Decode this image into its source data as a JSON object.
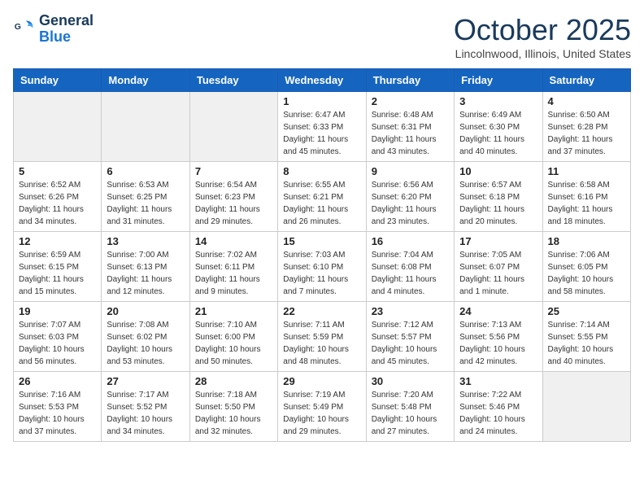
{
  "header": {
    "logo_line1": "General",
    "logo_line2": "Blue",
    "month_title": "October 2025",
    "location": "Lincolnwood, Illinois, United States"
  },
  "weekdays": [
    "Sunday",
    "Monday",
    "Tuesday",
    "Wednesday",
    "Thursday",
    "Friday",
    "Saturday"
  ],
  "weeks": [
    [
      {
        "day": "",
        "info": "",
        "gray": true
      },
      {
        "day": "",
        "info": "",
        "gray": true
      },
      {
        "day": "",
        "info": "",
        "gray": true
      },
      {
        "day": "1",
        "info": "Sunrise: 6:47 AM\nSunset: 6:33 PM\nDaylight: 11 hours\nand 45 minutes.",
        "gray": false
      },
      {
        "day": "2",
        "info": "Sunrise: 6:48 AM\nSunset: 6:31 PM\nDaylight: 11 hours\nand 43 minutes.",
        "gray": false
      },
      {
        "day": "3",
        "info": "Sunrise: 6:49 AM\nSunset: 6:30 PM\nDaylight: 11 hours\nand 40 minutes.",
        "gray": false
      },
      {
        "day": "4",
        "info": "Sunrise: 6:50 AM\nSunset: 6:28 PM\nDaylight: 11 hours\nand 37 minutes.",
        "gray": false
      }
    ],
    [
      {
        "day": "5",
        "info": "Sunrise: 6:52 AM\nSunset: 6:26 PM\nDaylight: 11 hours\nand 34 minutes.",
        "gray": false
      },
      {
        "day": "6",
        "info": "Sunrise: 6:53 AM\nSunset: 6:25 PM\nDaylight: 11 hours\nand 31 minutes.",
        "gray": false
      },
      {
        "day": "7",
        "info": "Sunrise: 6:54 AM\nSunset: 6:23 PM\nDaylight: 11 hours\nand 29 minutes.",
        "gray": false
      },
      {
        "day": "8",
        "info": "Sunrise: 6:55 AM\nSunset: 6:21 PM\nDaylight: 11 hours\nand 26 minutes.",
        "gray": false
      },
      {
        "day": "9",
        "info": "Sunrise: 6:56 AM\nSunset: 6:20 PM\nDaylight: 11 hours\nand 23 minutes.",
        "gray": false
      },
      {
        "day": "10",
        "info": "Sunrise: 6:57 AM\nSunset: 6:18 PM\nDaylight: 11 hours\nand 20 minutes.",
        "gray": false
      },
      {
        "day": "11",
        "info": "Sunrise: 6:58 AM\nSunset: 6:16 PM\nDaylight: 11 hours\nand 18 minutes.",
        "gray": false
      }
    ],
    [
      {
        "day": "12",
        "info": "Sunrise: 6:59 AM\nSunset: 6:15 PM\nDaylight: 11 hours\nand 15 minutes.",
        "gray": false
      },
      {
        "day": "13",
        "info": "Sunrise: 7:00 AM\nSunset: 6:13 PM\nDaylight: 11 hours\nand 12 minutes.",
        "gray": false
      },
      {
        "day": "14",
        "info": "Sunrise: 7:02 AM\nSunset: 6:11 PM\nDaylight: 11 hours\nand 9 minutes.",
        "gray": false
      },
      {
        "day": "15",
        "info": "Sunrise: 7:03 AM\nSunset: 6:10 PM\nDaylight: 11 hours\nand 7 minutes.",
        "gray": false
      },
      {
        "day": "16",
        "info": "Sunrise: 7:04 AM\nSunset: 6:08 PM\nDaylight: 11 hours\nand 4 minutes.",
        "gray": false
      },
      {
        "day": "17",
        "info": "Sunrise: 7:05 AM\nSunset: 6:07 PM\nDaylight: 11 hours\nand 1 minute.",
        "gray": false
      },
      {
        "day": "18",
        "info": "Sunrise: 7:06 AM\nSunset: 6:05 PM\nDaylight: 10 hours\nand 58 minutes.",
        "gray": false
      }
    ],
    [
      {
        "day": "19",
        "info": "Sunrise: 7:07 AM\nSunset: 6:03 PM\nDaylight: 10 hours\nand 56 minutes.",
        "gray": false
      },
      {
        "day": "20",
        "info": "Sunrise: 7:08 AM\nSunset: 6:02 PM\nDaylight: 10 hours\nand 53 minutes.",
        "gray": false
      },
      {
        "day": "21",
        "info": "Sunrise: 7:10 AM\nSunset: 6:00 PM\nDaylight: 10 hours\nand 50 minutes.",
        "gray": false
      },
      {
        "day": "22",
        "info": "Sunrise: 7:11 AM\nSunset: 5:59 PM\nDaylight: 10 hours\nand 48 minutes.",
        "gray": false
      },
      {
        "day": "23",
        "info": "Sunrise: 7:12 AM\nSunset: 5:57 PM\nDaylight: 10 hours\nand 45 minutes.",
        "gray": false
      },
      {
        "day": "24",
        "info": "Sunrise: 7:13 AM\nSunset: 5:56 PM\nDaylight: 10 hours\nand 42 minutes.",
        "gray": false
      },
      {
        "day": "25",
        "info": "Sunrise: 7:14 AM\nSunset: 5:55 PM\nDaylight: 10 hours\nand 40 minutes.",
        "gray": false
      }
    ],
    [
      {
        "day": "26",
        "info": "Sunrise: 7:16 AM\nSunset: 5:53 PM\nDaylight: 10 hours\nand 37 minutes.",
        "gray": false
      },
      {
        "day": "27",
        "info": "Sunrise: 7:17 AM\nSunset: 5:52 PM\nDaylight: 10 hours\nand 34 minutes.",
        "gray": false
      },
      {
        "day": "28",
        "info": "Sunrise: 7:18 AM\nSunset: 5:50 PM\nDaylight: 10 hours\nand 32 minutes.",
        "gray": false
      },
      {
        "day": "29",
        "info": "Sunrise: 7:19 AM\nSunset: 5:49 PM\nDaylight: 10 hours\nand 29 minutes.",
        "gray": false
      },
      {
        "day": "30",
        "info": "Sunrise: 7:20 AM\nSunset: 5:48 PM\nDaylight: 10 hours\nand 27 minutes.",
        "gray": false
      },
      {
        "day": "31",
        "info": "Sunrise: 7:22 AM\nSunset: 5:46 PM\nDaylight: 10 hours\nand 24 minutes.",
        "gray": false
      },
      {
        "day": "",
        "info": "",
        "gray": true
      }
    ]
  ]
}
